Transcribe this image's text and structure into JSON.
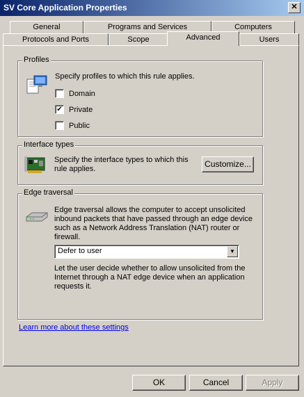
{
  "window": {
    "title": "SV Core Application Properties",
    "close_glyph": "✕"
  },
  "tabs_row1": [
    {
      "label": "General"
    },
    {
      "label": "Programs and Services"
    },
    {
      "label": "Computers"
    }
  ],
  "tabs_row2": [
    {
      "label": "Protocols and Ports"
    },
    {
      "label": "Scope"
    },
    {
      "label": "Advanced",
      "active": true
    },
    {
      "label": "Users"
    }
  ],
  "profiles": {
    "legend": "Profiles",
    "description": "Specify profiles to which this rule applies.",
    "options": [
      {
        "label": "Domain",
        "checked": false
      },
      {
        "label": "Private",
        "checked": true
      },
      {
        "label": "Public",
        "checked": false
      }
    ],
    "check_glyph": "✔"
  },
  "interface_types": {
    "legend": "Interface types",
    "description": "Specify the interface types to which this rule applies.",
    "button": "Customize..."
  },
  "edge_traversal": {
    "legend": "Edge traversal",
    "description": "Edge traversal allows the computer to accept unsolicited inbound packets that have passed through an edge device such as a Network Address Translation (NAT) router or firewall.",
    "selected": "Defer to user",
    "arrow_glyph": "▼",
    "detail": "Let the user decide whether to allow unsolicited from the Internet through a NAT edge device when an application requests it."
  },
  "learn_more": "Learn more about these settings",
  "footer": {
    "ok": "OK",
    "cancel": "Cancel",
    "apply": "Apply"
  }
}
